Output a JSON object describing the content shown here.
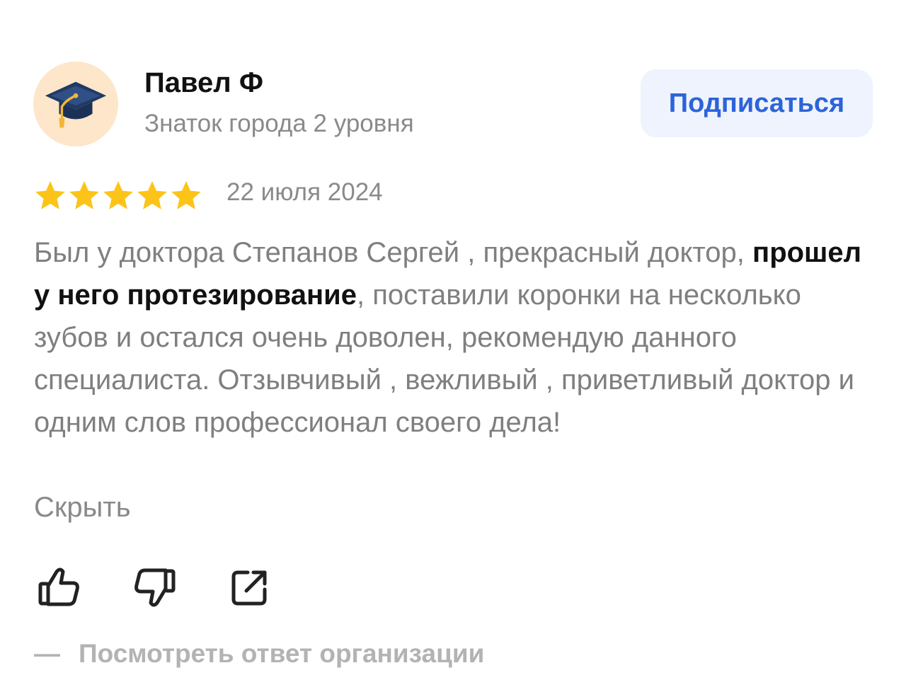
{
  "author": {
    "name": "Павел Ф",
    "level": "Знаток города 2 уровня",
    "avatar_icon": "graduation-cap-icon"
  },
  "subscribe_label": "Подписаться",
  "review": {
    "rating": 5,
    "rating_max": 5,
    "date": "22 июля 2024",
    "text_before": "Был у доктора Степанов Сергей , прекрасный доктор, ",
    "text_highlight": "прошел у него протезирование",
    "text_after": ", поставили коронки на несколько зубов и остался очень доволен, рекомендую данного специалиста. Отзывчивый , вежливый , приветливый доктор и одним слов профессионал своего дела!",
    "hide_label": "Скрыть"
  },
  "actions": {
    "like_icon": "thumbs-up-icon",
    "dislike_icon": "thumbs-down-icon",
    "share_icon": "share-icon"
  },
  "org_reply": {
    "dash": "—",
    "label": "Посмотреть ответ организации"
  },
  "colors": {
    "accent": "#2c63d9",
    "button_bg": "#eef3fd",
    "star": "#fcc419",
    "avatar_bg": "#fde6c9",
    "text_primary": "#111111",
    "text_secondary": "#8a8a8a"
  }
}
